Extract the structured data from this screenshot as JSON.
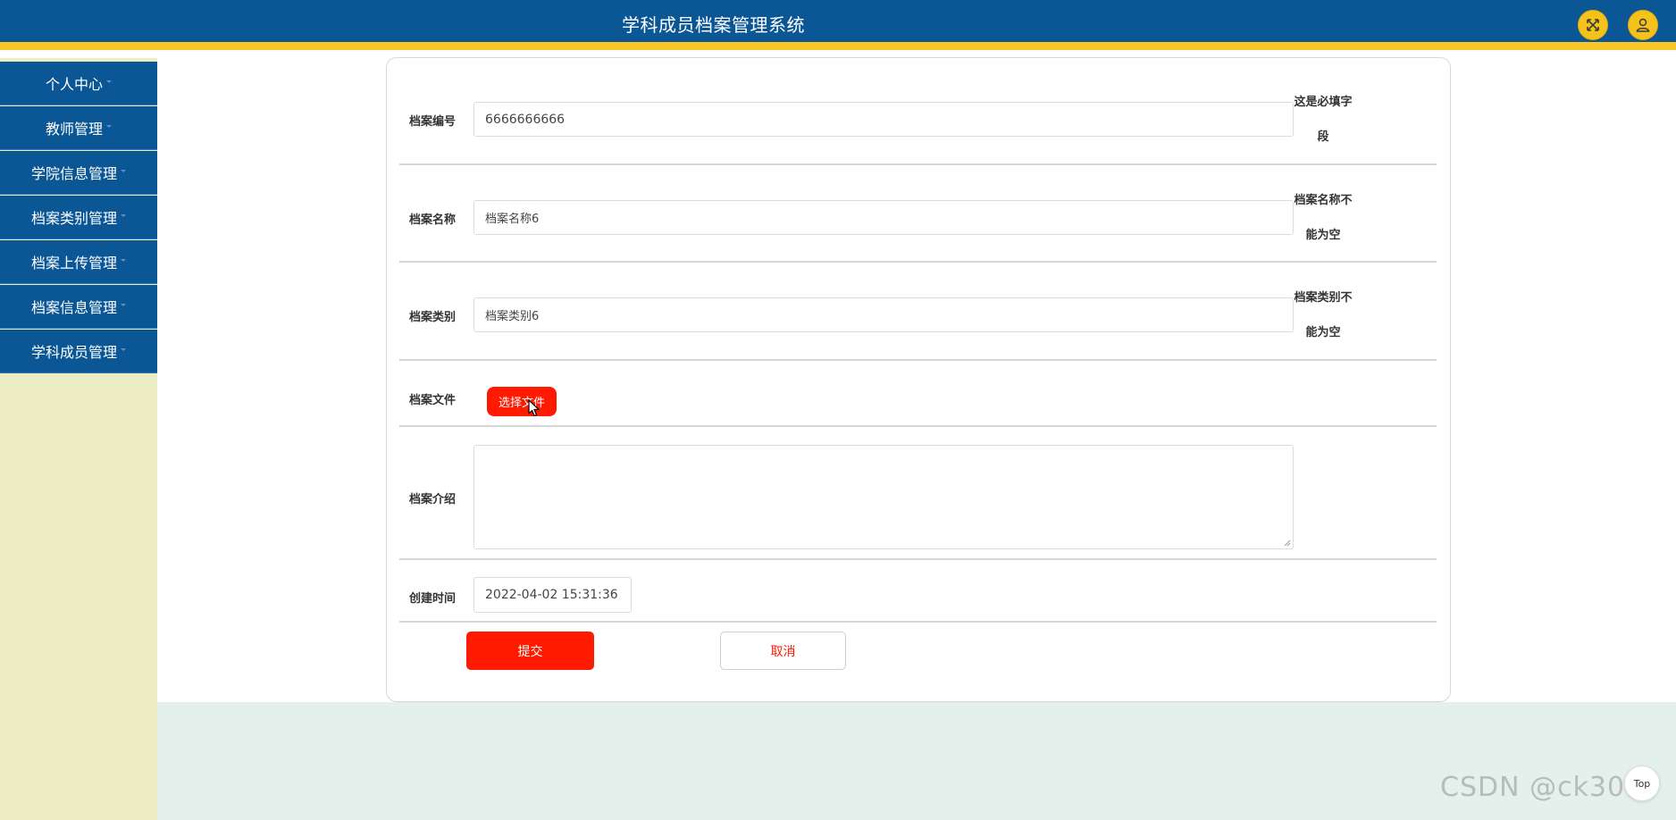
{
  "header": {
    "title": "学科成员档案管理系统",
    "icons": {
      "fullscreen": "expand-icon",
      "user": "user-icon"
    },
    "colors": {
      "background": "#0b5796",
      "accent_bar": "#f7c72a",
      "button": "#f5c21b"
    }
  },
  "sidebar": {
    "items": [
      {
        "label": "个人中心"
      },
      {
        "label": "教师管理"
      },
      {
        "label": "学院信息管理"
      },
      {
        "label": "档案类别管理"
      },
      {
        "label": "档案上传管理"
      },
      {
        "label": "档案信息管理"
      },
      {
        "label": "学科成员管理"
      }
    ]
  },
  "form": {
    "fields": {
      "code": {
        "label": "档案编号",
        "value": "6666666666",
        "hint": "这是必填字段"
      },
      "name": {
        "label": "档案名称",
        "value": "档案名称6",
        "hint": "档案名称不能为空"
      },
      "category": {
        "label": "档案类别",
        "value": "档案类别6",
        "hint": "档案类别不能为空"
      },
      "file": {
        "label": "档案文件",
        "button_label": "选择文件"
      },
      "intro": {
        "label": "档案介绍",
        "value": ""
      },
      "created": {
        "label": "创建时间",
        "value": "2022-04-02 15:31:36"
      }
    },
    "submit_label": "提交",
    "cancel_label": "取消",
    "colors": {
      "primary": "#ff1a00"
    }
  },
  "scroll_top": {
    "label": "Top"
  },
  "watermark": {
    "text": "CSDN @ck3017"
  }
}
